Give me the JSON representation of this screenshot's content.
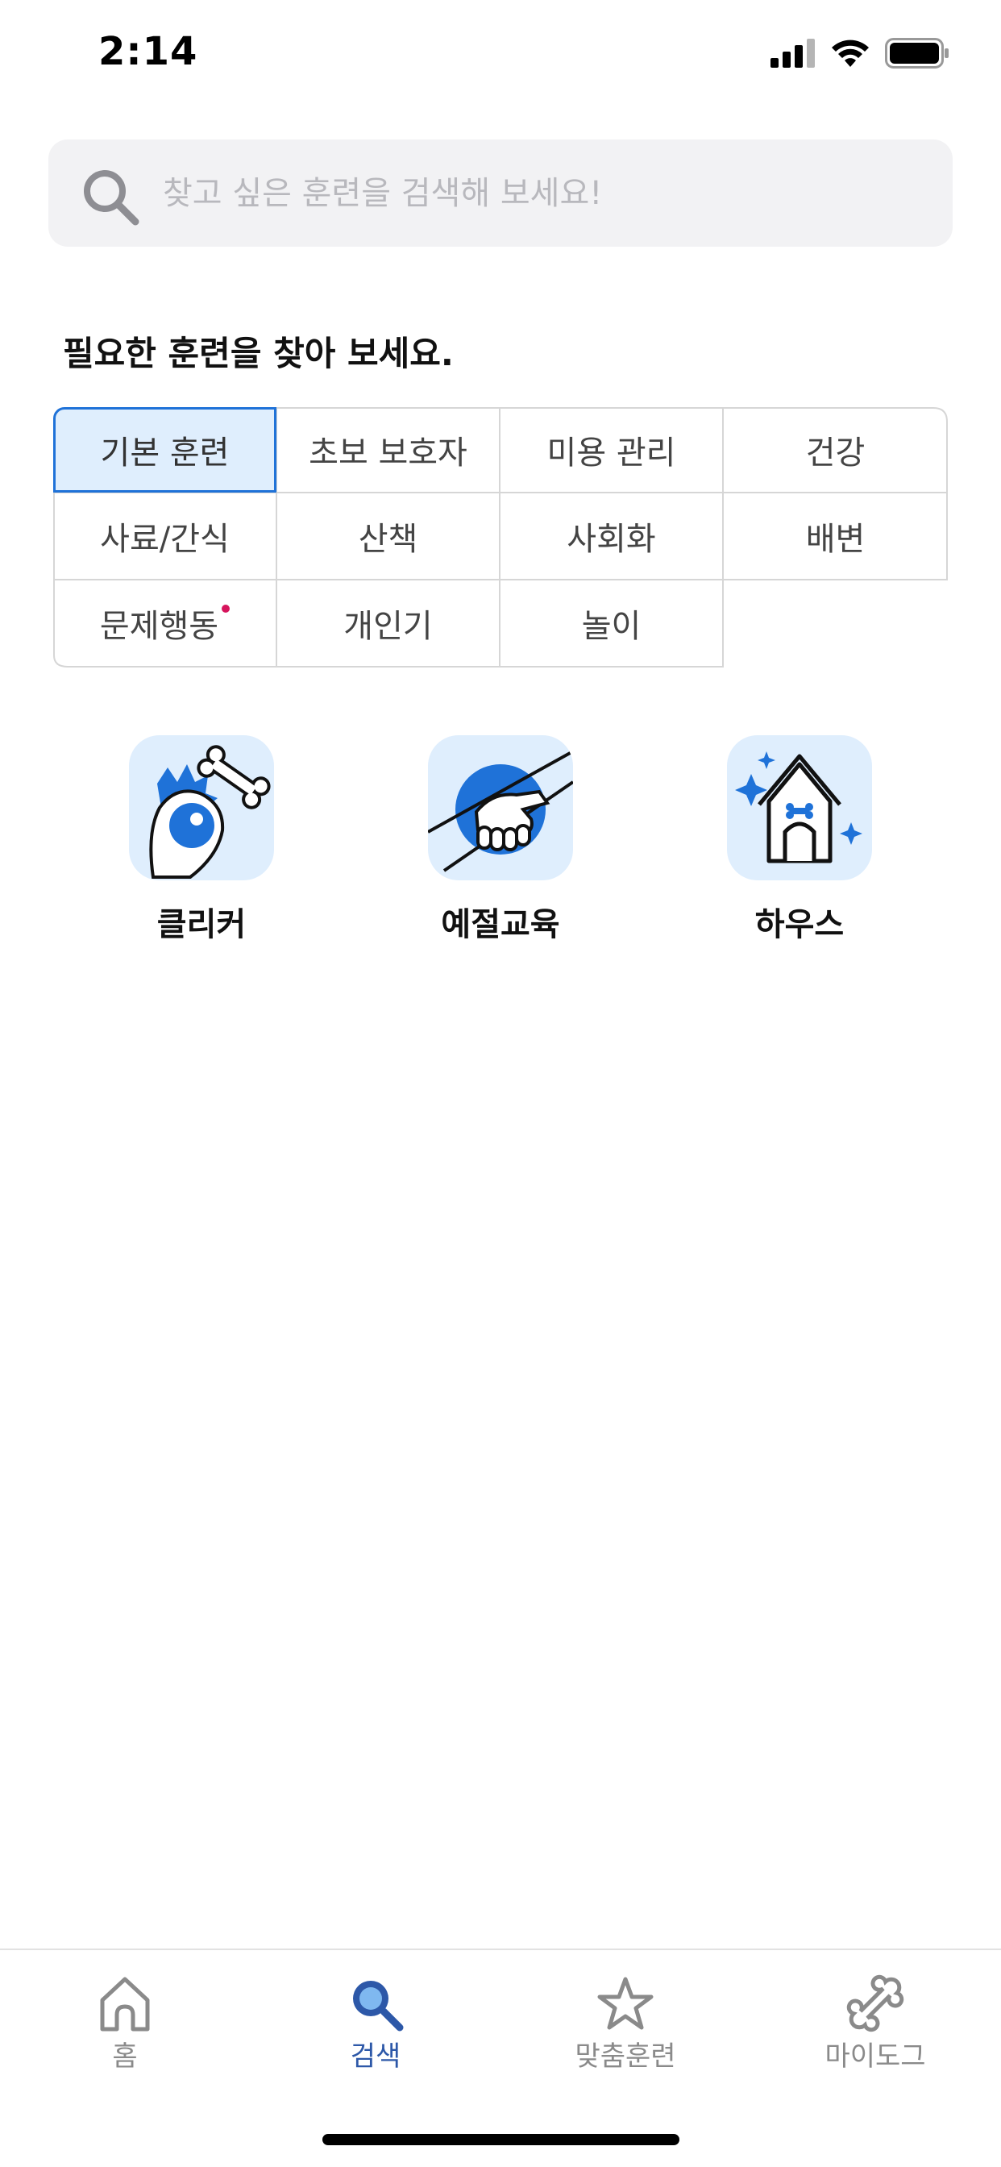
{
  "status_bar": {
    "time": "2:14"
  },
  "search": {
    "placeholder": "찾고 싶은 훈련을 검색해 보세요!",
    "value": ""
  },
  "section_title": "필요한 훈련을 찾아 보세요.",
  "categories": [
    {
      "label": "기본 훈련",
      "selected": true
    },
    {
      "label": "초보 보호자"
    },
    {
      "label": "미용 관리"
    },
    {
      "label": "건강"
    },
    {
      "label": "사료/간식"
    },
    {
      "label": "산책"
    },
    {
      "label": "사회화"
    },
    {
      "label": "배변"
    },
    {
      "label": "문제행동",
      "badge_dot": true
    },
    {
      "label": "개인기"
    },
    {
      "label": "놀이"
    }
  ],
  "feature_tiles": [
    {
      "label": "클리커",
      "icon": "clicker-icon"
    },
    {
      "label": "예절교육",
      "icon": "handshake-icon"
    },
    {
      "label": "하우스",
      "icon": "dog-house-icon"
    }
  ],
  "bottom_nav": [
    {
      "label": "홈",
      "icon": "home-icon",
      "active": false
    },
    {
      "label": "검색",
      "icon": "search-icon",
      "active": true
    },
    {
      "label": "맞춤훈련",
      "icon": "star-icon",
      "active": false
    },
    {
      "label": "마이도그",
      "icon": "bone-icon",
      "active": false
    }
  ],
  "colors": {
    "accent": "#1f72d8",
    "accent_light": "#dfeefd",
    "nav_active": "#2d58a8",
    "badge_dot": "#d6145c"
  }
}
